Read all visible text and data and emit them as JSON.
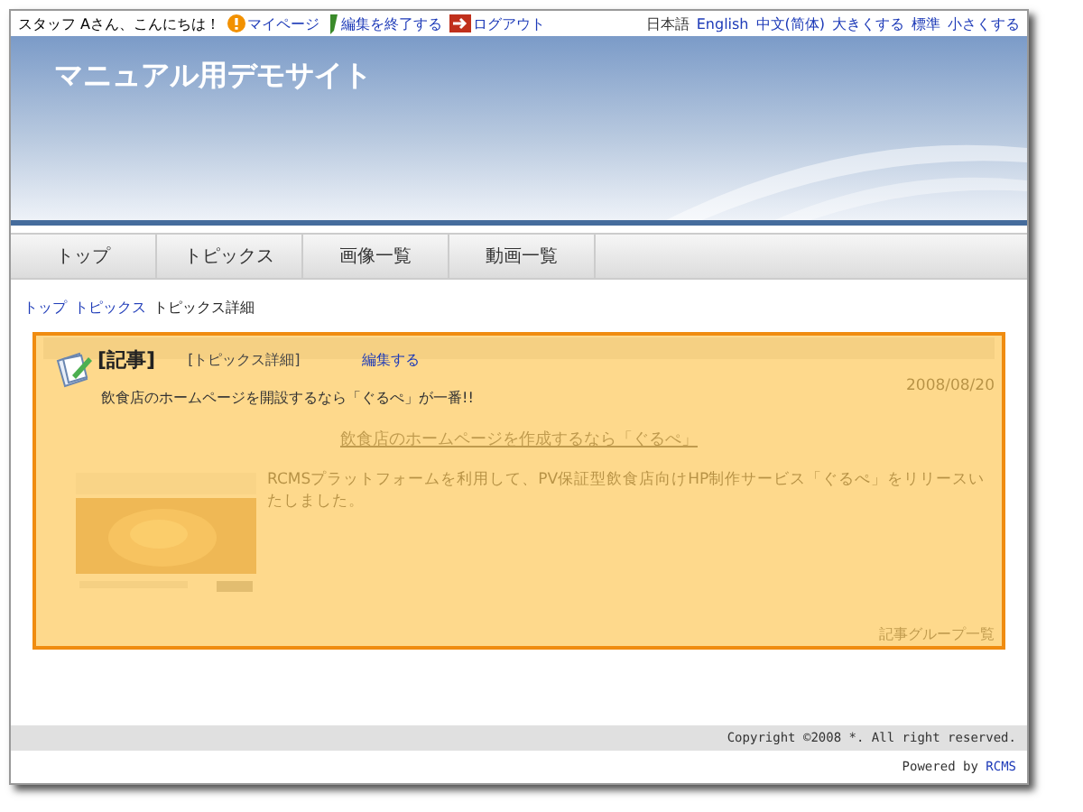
{
  "top_bar": {
    "greeting": "スタッフ Aさん、こんにちは！",
    "links": [
      {
        "label": "マイページ",
        "kind": "info"
      },
      {
        "label": "編集を終了する",
        "kind": "pen"
      },
      {
        "label": "ログアウト",
        "kind": "exit"
      }
    ],
    "languages": [
      {
        "label": "日本語",
        "selected": true
      },
      {
        "label": "English",
        "selected": false
      },
      {
        "label": "中文(简体)",
        "selected": false
      }
    ],
    "size_links": [
      "大きくする",
      "標準",
      "小さくする"
    ]
  },
  "header": {
    "site_title": "マニュアル用デモサイト"
  },
  "nav": [
    {
      "label": "トップ"
    },
    {
      "label": "トピックス"
    },
    {
      "label": "画像一覧"
    },
    {
      "label": "動画一覧"
    }
  ],
  "breadcrumb": [
    {
      "label": "トップ",
      "link": true
    },
    {
      "label": "トピックス",
      "link": true
    },
    {
      "label": "トピックス詳細",
      "link": false
    }
  ],
  "article": {
    "date": "2008/08/20",
    "heading": "飲食店のホームページを作成するなら「ぐるぺ」",
    "body": "RCMSプラットフォームを利用して、PV保証型飲食店向けHP制作サービス「ぐるぺ」をリリースいたしました。",
    "group_link": "記事グループ一覧"
  },
  "edit_overlay": {
    "type_label": "[記事]",
    "page_label": "[トピックス詳細]",
    "edit_link": "編集する",
    "summary": "飲食店のホームページを開設するなら「ぐるぺ」が一番!!"
  },
  "footer": {
    "copyright": "Copyright ©2008 *. All right reserved.",
    "powered_by": "Powered by",
    "powered_link": "RCMS"
  }
}
